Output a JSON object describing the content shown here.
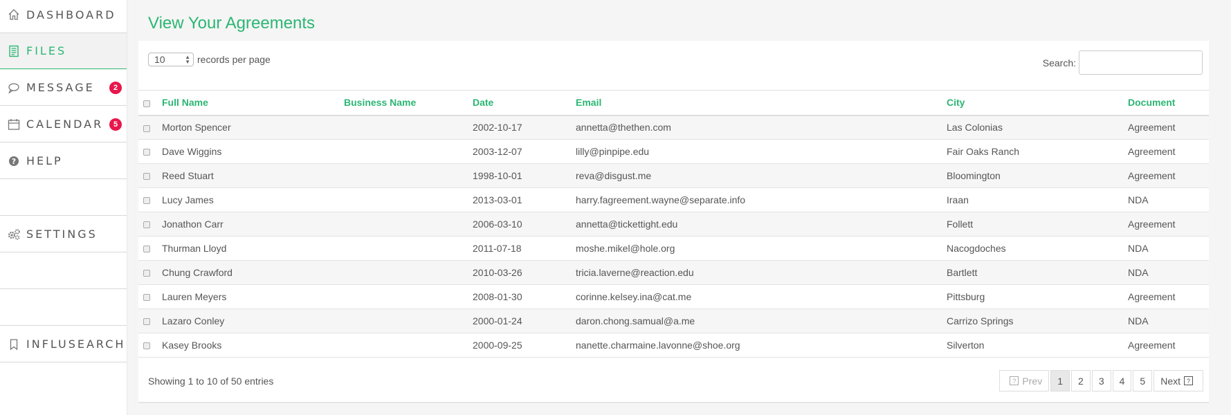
{
  "sidebar": {
    "items": [
      {
        "label": "DASHBOARD",
        "icon": "home-icon"
      },
      {
        "label": "FILES",
        "icon": "document-icon"
      },
      {
        "label": "MESSAGE",
        "icon": "chat-icon",
        "badge": "2"
      },
      {
        "label": "CALENDAR",
        "icon": "calendar-icon",
        "badge": "5"
      },
      {
        "label": "HELP",
        "icon": "question-icon"
      },
      {
        "label": "SETTINGS",
        "icon": "gears-icon"
      },
      {
        "label": "INFLUSEARCH",
        "icon": "bookmark-icon"
      }
    ]
  },
  "main": {
    "title": "View Your Agreements",
    "records_value": "10",
    "records_label": "records per page",
    "search_label": "Search:",
    "search_value": ""
  },
  "table": {
    "headers": [
      "Full Name",
      "Business Name",
      "Date",
      "Email",
      "City",
      "Document"
    ],
    "rows": [
      [
        "Morton Spencer",
        "",
        "2002-10-17",
        "annetta@thethen.com",
        "Las Colonias",
        "Agreement"
      ],
      [
        "Dave Wiggins",
        "",
        "2003-12-07",
        "lilly@pinpipe.edu",
        "Fair Oaks Ranch",
        "Agreement"
      ],
      [
        "Reed Stuart",
        "",
        "1998-10-01",
        "reva@disgust.me",
        "Bloomington",
        "Agreement"
      ],
      [
        "Lucy James",
        "",
        "2013-03-01",
        "harry.fagreement.wayne@separate.info",
        "Iraan",
        "NDA"
      ],
      [
        "Jonathon Carr",
        "",
        "2006-03-10",
        "annetta@tickettight.edu",
        "Follett",
        "Agreement"
      ],
      [
        "Thurman Lloyd",
        "",
        "2011-07-18",
        "moshe.mikel@hole.org",
        "Nacogdoches",
        "NDA"
      ],
      [
        "Chung Crawford",
        "",
        "2010-03-26",
        "tricia.laverne@reaction.edu",
        "Bartlett",
        "NDA"
      ],
      [
        "Lauren Meyers",
        "",
        "2008-01-30",
        "corinne.kelsey.ina@cat.me",
        "Pittsburg",
        "Agreement"
      ],
      [
        "Lazaro Conley",
        "",
        "2000-01-24",
        "daron.chong.samual@a.me",
        "Carrizo Springs",
        "NDA"
      ],
      [
        "Kasey Brooks",
        "",
        "2000-09-25",
        "nanette.charmaine.lavonne@shoe.org",
        "Silverton",
        "Agreement"
      ]
    ]
  },
  "footer": {
    "info": "Showing 1 to 10 of 50 entries",
    "prev": "Prev",
    "next": "Next",
    "pages": [
      "1",
      "2",
      "3",
      "4",
      "5"
    ],
    "current_page": "1"
  },
  "colors": {
    "accent": "#2bb673",
    "badge": "#e8174b"
  }
}
